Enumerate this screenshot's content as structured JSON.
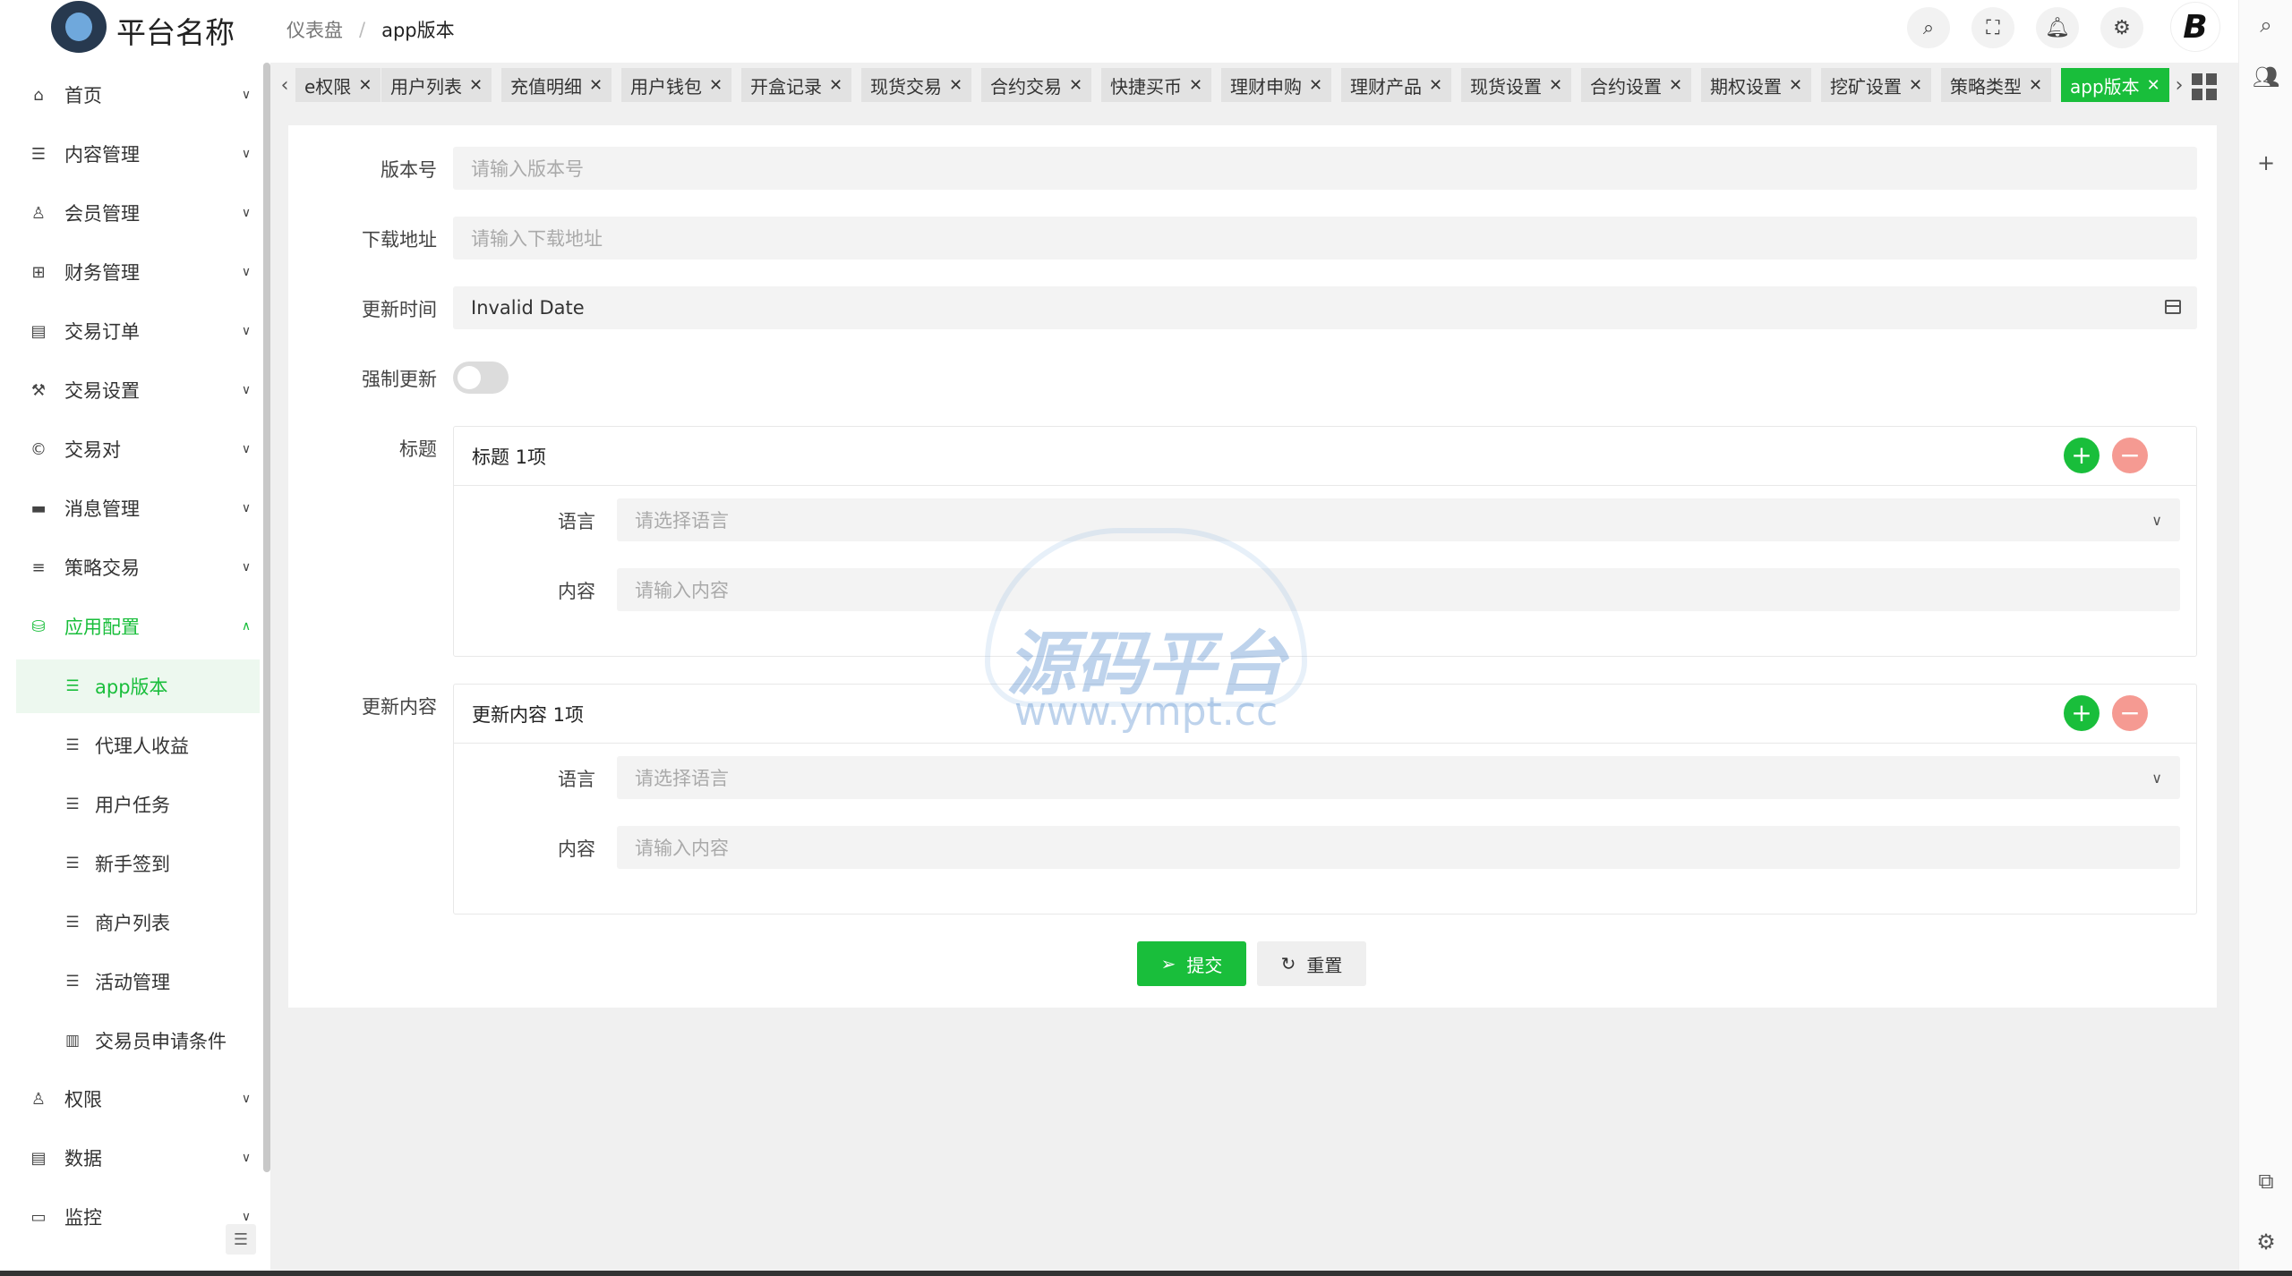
{
  "header": {
    "platform_name": "平台名称",
    "breadcrumb": [
      "仪表盘",
      "/",
      "app版本"
    ],
    "brand_mark": "B"
  },
  "sidebar": {
    "items": [
      {
        "label": "首页",
        "icon": "home-icon"
      },
      {
        "label": "内容管理",
        "icon": "list-icon"
      },
      {
        "label": "会员管理",
        "icon": "user-icon"
      },
      {
        "label": "财务管理",
        "icon": "finance-icon"
      },
      {
        "label": "交易订单",
        "icon": "order-icon"
      },
      {
        "label": "交易设置",
        "icon": "wrench-icon"
      },
      {
        "label": "交易对",
        "icon": "copyright-icon"
      },
      {
        "label": "消息管理",
        "icon": "message-icon"
      },
      {
        "label": "策略交易",
        "icon": "menu-icon"
      },
      {
        "label": "应用配置",
        "icon": "config-icon",
        "expanded": true
      }
    ],
    "sub_items": [
      {
        "label": "app版本",
        "active": true
      },
      {
        "label": "代理人收益"
      },
      {
        "label": "用户任务"
      },
      {
        "label": "新手签到"
      },
      {
        "label": "商户列表"
      },
      {
        "label": "活动管理"
      },
      {
        "label": "交易员申请条件"
      }
    ],
    "bottom_items": [
      {
        "label": "权限",
        "icon": "permission-icon"
      },
      {
        "label": "数据",
        "icon": "data-icon"
      },
      {
        "label": "监控",
        "icon": "monitor-icon"
      }
    ]
  },
  "tabs": [
    {
      "label": "e权限"
    },
    {
      "label": "用户列表"
    },
    {
      "label": "充值明细"
    },
    {
      "label": "用户钱包"
    },
    {
      "label": "开盒记录"
    },
    {
      "label": "现货交易"
    },
    {
      "label": "合约交易"
    },
    {
      "label": "快捷买币"
    },
    {
      "label": "理财申购"
    },
    {
      "label": "理财产品"
    },
    {
      "label": "现货设置"
    },
    {
      "label": "合约设置"
    },
    {
      "label": "期权设置"
    },
    {
      "label": "挖矿设置"
    },
    {
      "label": "策略类型"
    },
    {
      "label": "app版本",
      "active": true
    }
  ],
  "form": {
    "version_label": "版本号",
    "version_placeholder": "请输入版本号",
    "download_label": "下载地址",
    "download_placeholder": "请输入下载地址",
    "update_time_label": "更新时间",
    "update_time_value": "Invalid Date",
    "force_update_label": "强制更新",
    "force_update_on": false,
    "title_label": "标题",
    "title_card": {
      "header": "标题 1项",
      "language_label": "语言",
      "language_placeholder": "请选择语言",
      "content_label": "内容",
      "content_placeholder": "请输入内容"
    },
    "update_content_label": "更新内容",
    "update_card": {
      "header": "更新内容 1项",
      "language_label": "语言",
      "language_placeholder": "请选择语言",
      "content_label": "内容",
      "content_placeholder": "请输入内容"
    },
    "submit_label": "提交",
    "reset_label": "重置"
  },
  "watermark": {
    "text": "源码平台",
    "url": "www.ympt.cc"
  },
  "colors": {
    "accent": "#19be3b",
    "danger_soft": "#f59a92",
    "content_bg": "#f0f0f0"
  }
}
